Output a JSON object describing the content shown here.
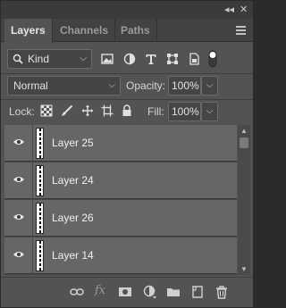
{
  "window": {
    "collapse_label": "◂◂",
    "close_label": "✕"
  },
  "tabs": [
    {
      "label": "Layers",
      "active": true
    },
    {
      "label": "Channels",
      "active": false
    },
    {
      "label": "Paths",
      "active": false
    }
  ],
  "filter": {
    "kind_label": "Kind",
    "icons": [
      "image-filter-icon",
      "adjustment-filter-icon",
      "type-filter-icon",
      "shape-filter-icon",
      "smart-object-filter-icon",
      "filter-toggle-icon"
    ]
  },
  "blend": {
    "mode": "Normal",
    "opacity_label": "Opacity:",
    "opacity_value": "100%"
  },
  "lock": {
    "label": "Lock:",
    "fill_label": "Fill:",
    "fill_value": "100%",
    "icons": [
      "lock-transparent-icon",
      "lock-image-icon",
      "lock-position-icon",
      "lock-artboard-icon",
      "lock-all-icon"
    ]
  },
  "layers": [
    {
      "name": "Layer 25",
      "visible": true
    },
    {
      "name": "Layer 24",
      "visible": true
    },
    {
      "name": "Layer 26",
      "visible": true
    },
    {
      "name": "Layer 14",
      "visible": true
    }
  ],
  "bottom_icons": [
    "link-layers-icon",
    "fx-icon",
    "add-mask-icon",
    "adjustment-layer-icon",
    "new-group-icon",
    "new-layer-icon",
    "delete-layer-icon"
  ],
  "colors": {
    "panel": "#535353",
    "layer_row": "#666666",
    "tab_bar": "#424242"
  }
}
